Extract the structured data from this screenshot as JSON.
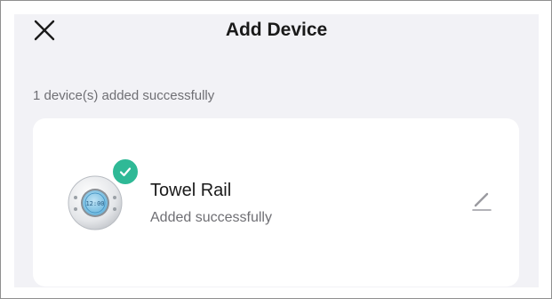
{
  "header": {
    "title": "Add Device",
    "close_icon": "close-icon"
  },
  "summary": {
    "status_text": "1 device(s) added successfully"
  },
  "device": {
    "name": "Towel Rail",
    "status": "Added successfully",
    "display_reading": "12:00",
    "badge_icon": "check-icon",
    "edit_icon": "pencil-icon",
    "badge_color": "#2fb996"
  },
  "colors": {
    "screen_background": "#f2f2f6",
    "card_background": "#ffffff",
    "text_primary": "#1a1a1a",
    "text_secondary": "#6f6f74"
  }
}
